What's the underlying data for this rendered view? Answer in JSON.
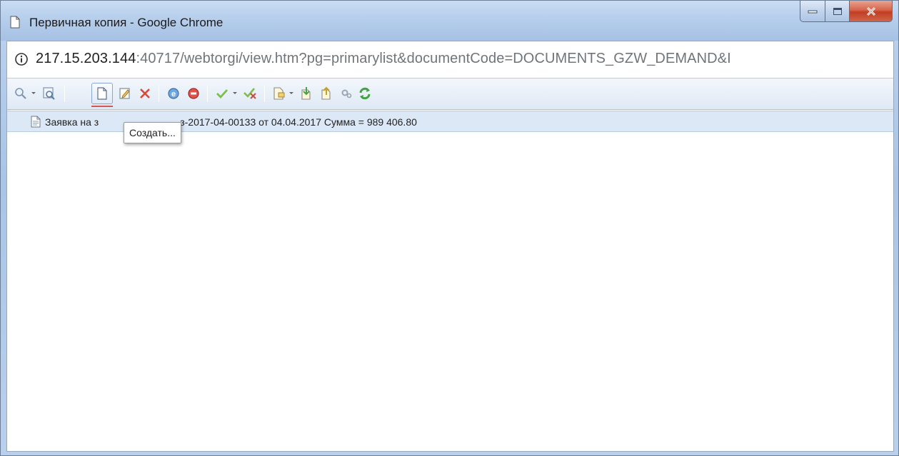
{
  "window": {
    "title": "Первичная копия - Google Chrome"
  },
  "address_bar": {
    "host": "217.15.203.144",
    "rest": ":40717/webtorgi/view.htm?pg=primarylist&documentCode=DOCUMENTS_GZW_DEMAND&I"
  },
  "toolbar": {
    "icons": [
      "search-icon",
      "dropdown-arrow-icon",
      "filter-search-icon",
      "new-document-icon",
      "edit-icon",
      "delete-icon",
      "ie-icon",
      "stop-icon",
      "checkmark-icon",
      "dropdown-arrow-icon",
      "uncheck-icon",
      "document-action-icon",
      "dropdown-arrow-icon",
      "import-icon",
      "export-icon",
      "settings-icon",
      "refresh-icon"
    ]
  },
  "list": {
    "rows": [
      {
        "text_left": "Заявка на з",
        "text_right": "з-2017-04-00133 от 04.04.2017 Сумма = 989 406.80"
      }
    ]
  },
  "tooltip": {
    "text": "Создать..."
  },
  "colors": {
    "accent_red": "#d9534f",
    "row_selected": "#dce8f6",
    "toolbar_bg": "#dfe9f5"
  }
}
